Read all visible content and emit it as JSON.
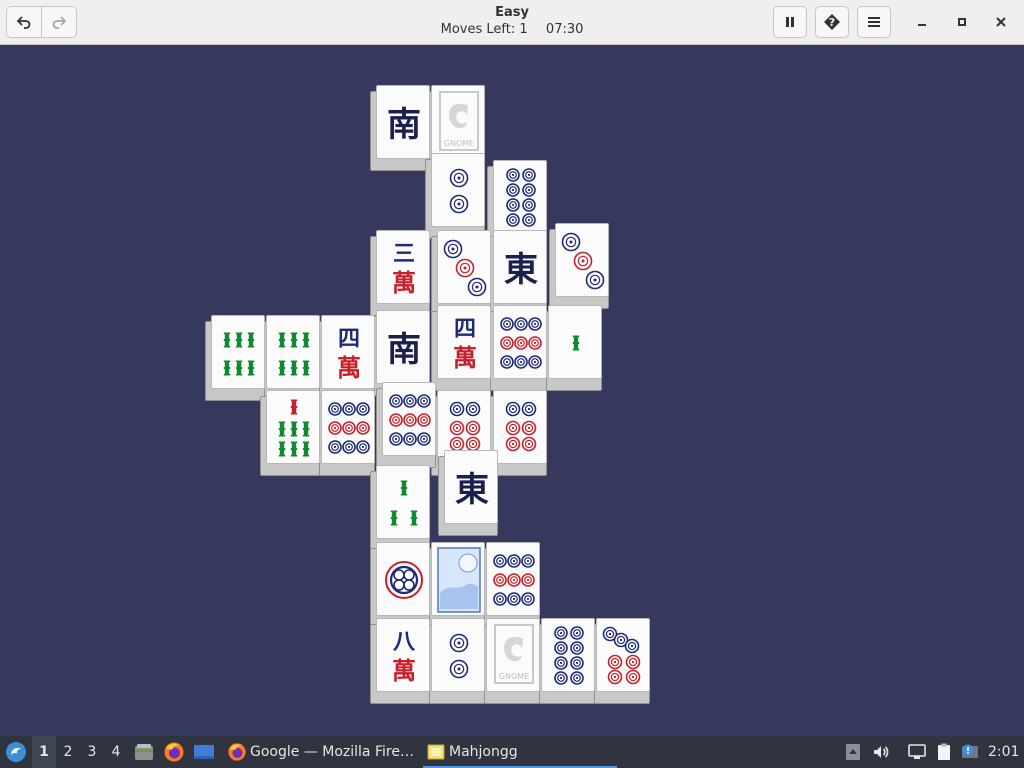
{
  "window": {
    "title": "Easy",
    "moves_left_label": "Moves Left:",
    "moves_left": "1",
    "timer": "07:30"
  },
  "header_buttons": {
    "undo_icon": "undo-arrow-icon",
    "redo_icon": "redo-arrow-icon",
    "pause_icon": "pause-icon",
    "hint_icon": "hint-question-icon",
    "menu_icon": "hamburger-menu-icon",
    "minimize_icon": "minimize-icon",
    "maximize_icon": "maximize-icon",
    "close_icon": "close-icon"
  },
  "board": {
    "background_color": "#36385d",
    "tiles": [
      {
        "face": "wind-south",
        "label": "南"
      },
      {
        "face": "gnome",
        "label": "GNOME"
      },
      {
        "face": "circle-2"
      },
      {
        "face": "circle-8"
      },
      {
        "face": "character-3",
        "label": "三",
        "suit_label": "萬"
      },
      {
        "face": "circle-3"
      },
      {
        "face": "wind-east",
        "label": "東"
      },
      {
        "face": "circle-3"
      },
      {
        "face": "bamboo-6"
      },
      {
        "face": "bamboo-6"
      },
      {
        "face": "character-4",
        "label": "四",
        "suit_label": "萬"
      },
      {
        "face": "wind-south",
        "label": "南"
      },
      {
        "face": "character-4",
        "label": "四",
        "suit_label": "萬"
      },
      {
        "face": "circle-9"
      },
      {
        "face": "bamboo-1"
      },
      {
        "face": "bamboo-7"
      },
      {
        "face": "circle-9"
      },
      {
        "face": "circle-9"
      },
      {
        "face": "circle-6"
      },
      {
        "face": "circle-6"
      },
      {
        "face": "bamboo-3"
      },
      {
        "face": "wind-east",
        "label": "東"
      },
      {
        "face": "circle-1"
      },
      {
        "face": "season-winter"
      },
      {
        "face": "circle-9"
      },
      {
        "face": "character-8",
        "label": "八",
        "suit_label": "萬"
      },
      {
        "face": "circle-2"
      },
      {
        "face": "gnome",
        "label": "GNOME"
      },
      {
        "face": "circle-8"
      },
      {
        "face": "circle-7"
      }
    ]
  },
  "taskbar": {
    "start_icon": "start-menu-icon",
    "workspaces": [
      "1",
      "2",
      "3",
      "4"
    ],
    "active_workspace": "1",
    "quicklaunch": [
      "files-icon",
      "firefox-icon",
      "show-desktop-icon"
    ],
    "tasks": [
      {
        "label": "Google — Mozilla Fire…",
        "icon": "firefox-icon"
      },
      {
        "label": "Mahjongg",
        "icon": "mahjongg-icon"
      }
    ],
    "tray": [
      "tray-expand-icon",
      "volume-icon",
      "network-icon",
      "clipboard-icon",
      "updates-icon"
    ],
    "clock": "2:01"
  }
}
